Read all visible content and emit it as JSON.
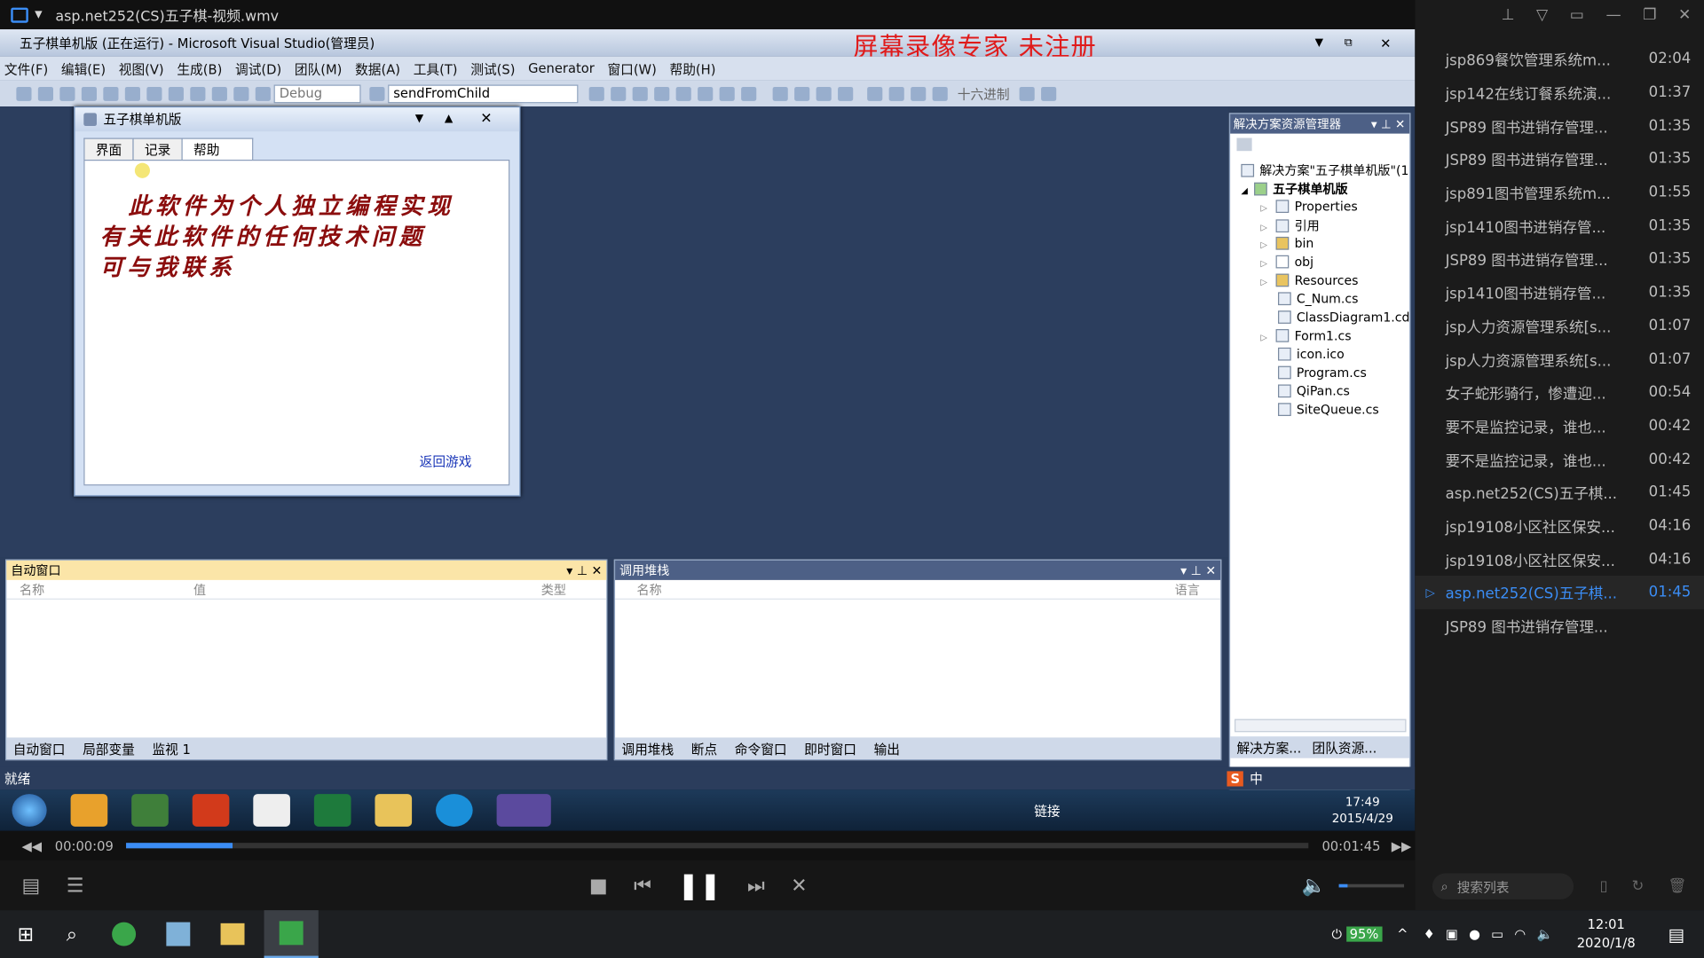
{
  "player": {
    "file_title": "asp.net252(CS)五子棋-视频.wmv",
    "time_current": "00:00:09",
    "time_total": "00:01:45",
    "progress": 0.09,
    "search_placeholder": "搜索列表"
  },
  "vs": {
    "title": "五子棋单机版 (正在运行) - Microsoft Visual Studio(管理员)",
    "watermark": "屏幕录像专家  未注册",
    "menu": [
      "文件(F)",
      "编辑(E)",
      "视图(V)",
      "生成(B)",
      "调试(D)",
      "团队(M)",
      "数据(A)",
      "工具(T)",
      "测试(S)",
      "Generator",
      "窗口(W)",
      "帮助(H)"
    ],
    "config": "Debug",
    "find_combo": "sendFromChild",
    "hex_label": "十六进制",
    "status": "就绪"
  },
  "child": {
    "title": "五子棋单机版",
    "tabs": [
      "界面",
      "记录",
      "帮助"
    ],
    "help_lines": [
      "此软件为个人独立编程实现",
      "有关此软件的任何技术问题",
      "可与我联系"
    ],
    "back_link": "返回游戏"
  },
  "solution": {
    "header": "解决方案资源管理器",
    "root": "解决方案\"五子棋单机版\"(1",
    "project": "五子棋单机版",
    "items": [
      "Properties",
      "引用",
      "bin",
      "obj",
      "Resources",
      "C_Num.cs",
      "ClassDiagram1.cd",
      "Form1.cs",
      "icon.ico",
      "Program.cs",
      "QiPan.cs",
      "SiteQueue.cs"
    ],
    "bottom_tabs": [
      "解决方案...",
      "团队资源..."
    ]
  },
  "autos": {
    "header": "自动窗口",
    "cols": [
      "名称",
      "值",
      "类型"
    ],
    "tabs": [
      "自动窗口",
      "局部变量",
      "监视 1"
    ]
  },
  "callstack": {
    "header": "调用堆栈",
    "cols": [
      "名称",
      "语言"
    ],
    "tabs": [
      "调用堆栈",
      "断点",
      "命令窗口",
      "即时窗口",
      "输出"
    ]
  },
  "win7": {
    "time": "17:49",
    "date": "2015/4/29",
    "link": "链接",
    "ime": "中"
  },
  "playlist": [
    {
      "name": "jsp869餐饮管理系统m...",
      "dur": "02:04"
    },
    {
      "name": "jsp142在线订餐系统演...",
      "dur": "01:37"
    },
    {
      "name": "JSP89 图书进销存管理...",
      "dur": "01:35"
    },
    {
      "name": "JSP89 图书进销存管理...",
      "dur": "01:35"
    },
    {
      "name": "jsp891图书管理系统m...",
      "dur": "01:55"
    },
    {
      "name": "jsp1410图书进销存管...",
      "dur": "01:35"
    },
    {
      "name": "JSP89 图书进销存管理...",
      "dur": "01:35"
    },
    {
      "name": "jsp1410图书进销存管...",
      "dur": "01:35"
    },
    {
      "name": "jsp人力资源管理系统[s...",
      "dur": "01:07"
    },
    {
      "name": "jsp人力资源管理系统[s...",
      "dur": "01:07"
    },
    {
      "name": "女子蛇形骑行，惨遭迎...",
      "dur": "00:54"
    },
    {
      "name": "要不是监控记录，谁也...",
      "dur": "00:42"
    },
    {
      "name": "要不是监控记录，谁也...",
      "dur": "00:42"
    },
    {
      "name": "asp.net252(CS)五子棋...",
      "dur": "01:45"
    },
    {
      "name": "jsp19108小区社区保安...",
      "dur": "04:16"
    },
    {
      "name": "jsp19108小区社区保安...",
      "dur": "04:16"
    },
    {
      "name": "asp.net252(CS)五子棋...",
      "dur": "01:45"
    },
    {
      "name": "JSP89 图书进销存管理...",
      "dur": ""
    }
  ],
  "win10": {
    "battery": "95%",
    "time": "12:01",
    "date": "2020/1/8"
  }
}
